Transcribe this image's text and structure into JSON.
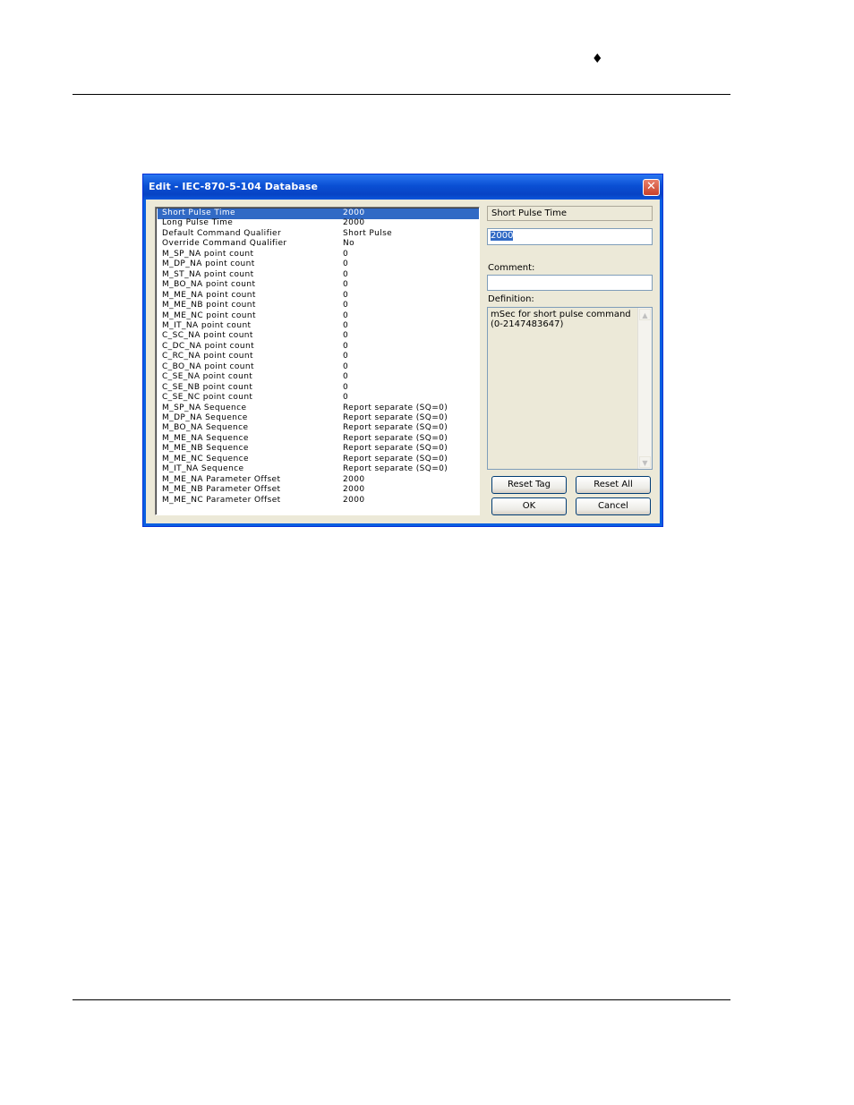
{
  "header": {
    "bullet": "♦"
  },
  "dialog": {
    "title": "Edit - IEC-870-5-104 Database",
    "close_glyph": "✕",
    "rows": [
      {
        "name": "Short Pulse Time",
        "value": "2000"
      },
      {
        "name": "Long Pulse Time",
        "value": "2000"
      },
      {
        "name": "Default Command Qualifier",
        "value": "Short Pulse"
      },
      {
        "name": "Override Command Qualifier",
        "value": "No"
      },
      {
        "name": "M_SP_NA point count",
        "value": "0"
      },
      {
        "name": "M_DP_NA point count",
        "value": "0"
      },
      {
        "name": "M_ST_NA point count",
        "value": "0"
      },
      {
        "name": "M_BO_NA point count",
        "value": "0"
      },
      {
        "name": "M_ME_NA point count",
        "value": "0"
      },
      {
        "name": "M_ME_NB point count",
        "value": "0"
      },
      {
        "name": "M_ME_NC point count",
        "value": "0"
      },
      {
        "name": "M_IT_NA point count",
        "value": "0"
      },
      {
        "name": "C_SC_NA point count",
        "value": "0"
      },
      {
        "name": "C_DC_NA point count",
        "value": "0"
      },
      {
        "name": "C_RC_NA point count",
        "value": "0"
      },
      {
        "name": "C_BO_NA point count",
        "value": "0"
      },
      {
        "name": "C_SE_NA point count",
        "value": "0"
      },
      {
        "name": "C_SE_NB point count",
        "value": "0"
      },
      {
        "name": "C_SE_NC point count",
        "value": "0"
      },
      {
        "name": "M_SP_NA Sequence",
        "value": "Report separate (SQ=0)"
      },
      {
        "name": "M_DP_NA Sequence",
        "value": "Report separate (SQ=0)"
      },
      {
        "name": "M_BO_NA Sequence",
        "value": "Report separate (SQ=0)"
      },
      {
        "name": "M_ME_NA Sequence",
        "value": "Report separate (SQ=0)"
      },
      {
        "name": "M_ME_NB Sequence",
        "value": "Report separate (SQ=0)"
      },
      {
        "name": "M_ME_NC Sequence",
        "value": "Report separate (SQ=0)"
      },
      {
        "name": "M_IT_NA Sequence",
        "value": "Report separate (SQ=0)"
      },
      {
        "name": "M_ME_NA Parameter Offset",
        "value": "2000"
      },
      {
        "name": "M_ME_NB Parameter Offset",
        "value": "2000"
      },
      {
        "name": "M_ME_NC Parameter Offset",
        "value": "2000"
      }
    ],
    "selected_row": 0,
    "detail": {
      "param_name": "Short Pulse Time",
      "value": "2000",
      "comment_label": "Comment:",
      "comment_value": "",
      "definition_label": "Definition:",
      "definition_text": "mSec for short pulse command (0-2147483647)"
    },
    "buttons": {
      "reset_tag": "Reset Tag",
      "reset_all": "Reset All",
      "ok": "OK",
      "cancel": "Cancel"
    }
  }
}
